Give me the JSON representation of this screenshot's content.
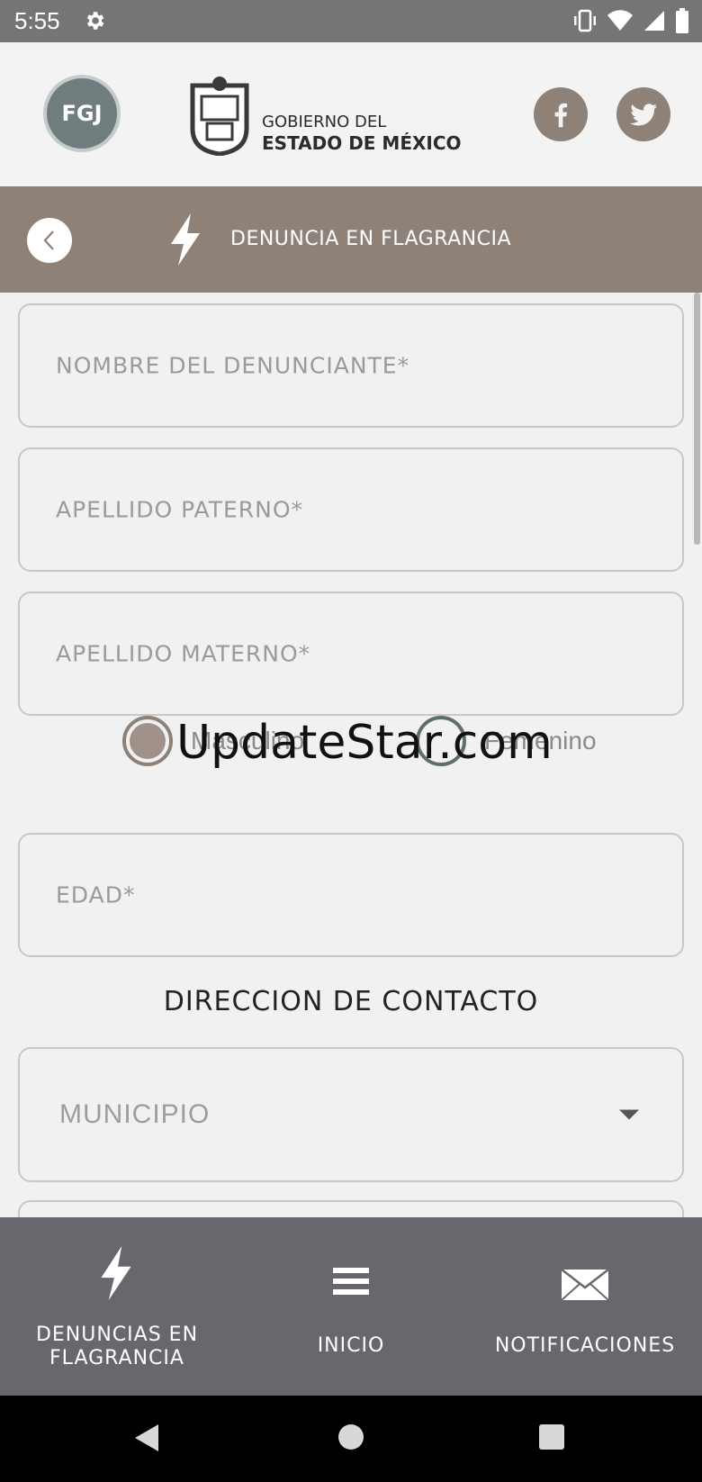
{
  "status_bar": {
    "time": "5:55",
    "icons": [
      "gear-icon",
      "vibrate-icon",
      "wifi-icon",
      "signal-icon",
      "battery-icon"
    ]
  },
  "header": {
    "fgj_logo_text": "FGJ",
    "gov_line1": "GOBIERNO DEL",
    "gov_line2": "ESTADO DE MÉXICO",
    "social": [
      "facebook-icon",
      "twitter-icon"
    ]
  },
  "titlebar": {
    "title": "DENUNCIA EN FLAGRANCIA"
  },
  "form": {
    "nombre_placeholder": "NOMBRE DEL DENUNCIANTE*",
    "apellido_paterno_placeholder": "APELLIDO PATERNO*",
    "apellido_materno_placeholder": "APELLIDO MATERNO*",
    "gender": {
      "options": [
        "Masculino",
        "Femenino"
      ],
      "selected": "Masculino"
    },
    "edad_placeholder": "EDAD*",
    "contact_section_title": "DIRECCION DE CONTACTO",
    "municipio_placeholder": "MUNICIPIO"
  },
  "watermark": "UpdateStar.com",
  "bottom_nav": {
    "items": [
      {
        "label_line1": "DENUNCIAS EN",
        "label_line2": "FLAGRANCIA",
        "icon": "bolt-icon"
      },
      {
        "label": "INICIO",
        "icon": "menu-icon"
      },
      {
        "label": "NOTIFICACIONES",
        "icon": "mail-icon"
      }
    ]
  },
  "colors": {
    "accent": "#8d8178",
    "status_bar": "#757575",
    "bottom_nav": "#66686d"
  }
}
